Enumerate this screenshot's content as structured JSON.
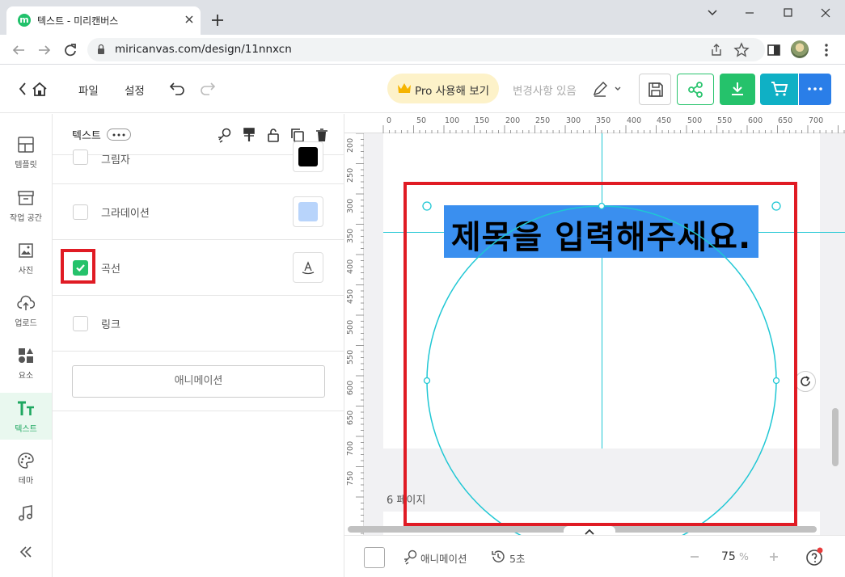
{
  "browser": {
    "tab_title": "텍스트 - 미리캔버스",
    "favicon_letter": "m",
    "url": "miricanvas.com/design/11nnxcn"
  },
  "header": {
    "menu_file": "파일",
    "menu_settings": "설정",
    "pro_button": "Pro 사용해 보기",
    "change_status": "변경사항 있음"
  },
  "sidebar": {
    "items": [
      {
        "label": "템플릿",
        "icon": "template-icon"
      },
      {
        "label": "작업 공간",
        "icon": "workspace-icon"
      },
      {
        "label": "사진",
        "icon": "photo-icon"
      },
      {
        "label": "업로드",
        "icon": "upload-icon"
      },
      {
        "label": "요소",
        "icon": "elements-icon"
      },
      {
        "label": "텍스트",
        "icon": "text-icon",
        "active": true
      },
      {
        "label": "테마",
        "icon": "palette-icon"
      },
      {
        "label": "",
        "icon": "music-icon"
      }
    ]
  },
  "panel": {
    "title": "텍스트",
    "options": [
      {
        "label": "그림자",
        "checked": false
      },
      {
        "label": "그라데이션",
        "checked": false
      },
      {
        "label": "곡선",
        "checked": true
      },
      {
        "label": "링크",
        "checked": false
      }
    ],
    "animation_button": "애니메이션"
  },
  "canvas": {
    "ruler_top": [
      "0",
      "50",
      "100",
      "150",
      "200",
      "250",
      "300",
      "350",
      "400",
      "450",
      "500",
      "550",
      "600",
      "650",
      "700"
    ],
    "ruler_left": [
      "200",
      "250",
      "300",
      "350",
      "400",
      "450",
      "500",
      "550",
      "600",
      "650",
      "700",
      "750"
    ],
    "curved_text": "제목을 입력해주세요.",
    "next_page_label": "6 페이지"
  },
  "bottombar": {
    "animation": "애니메이션",
    "autosave": "5초",
    "zoom_value": "75",
    "zoom_unit": "%"
  },
  "colors": {
    "brand_green": "#25c26b",
    "highlight_red": "#e01b24",
    "guide_cyan": "#1fc7d4",
    "text_selection_blue": "#3a8fef"
  }
}
